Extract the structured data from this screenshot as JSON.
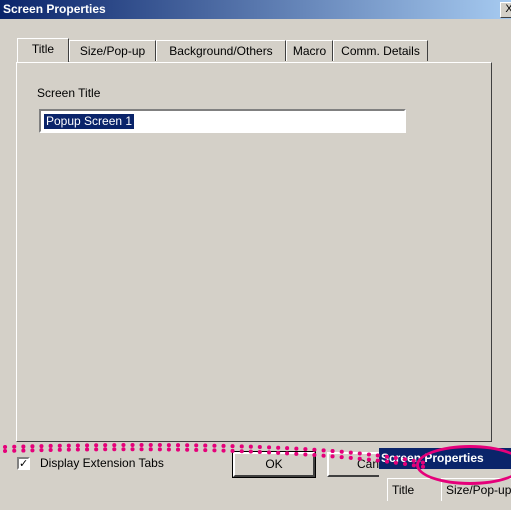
{
  "window": {
    "title": "Screen Properties",
    "close_label": "X"
  },
  "tabs": [
    {
      "label": "Title",
      "active": true
    },
    {
      "label": "Size/Pop-up",
      "active": false
    },
    {
      "label": "Background/Others",
      "active": false
    },
    {
      "label": "Macro",
      "active": false
    },
    {
      "label": "Comm. Details",
      "active": false
    }
  ],
  "screen_title": {
    "label": "Screen Title",
    "value": "Popup Screen 1"
  },
  "footer": {
    "checkbox_label": "Display Extension Tabs",
    "checkbox_checked": true,
    "ok_label": "OK",
    "cancel_label": "Can"
  },
  "inset": {
    "title": "Screen Properties",
    "tabs": [
      "Title",
      "Size/Pop-up"
    ]
  },
  "colors": {
    "highlight": "#e5007a",
    "titlebar": "#0a246a",
    "face": "#d4d0c8"
  }
}
